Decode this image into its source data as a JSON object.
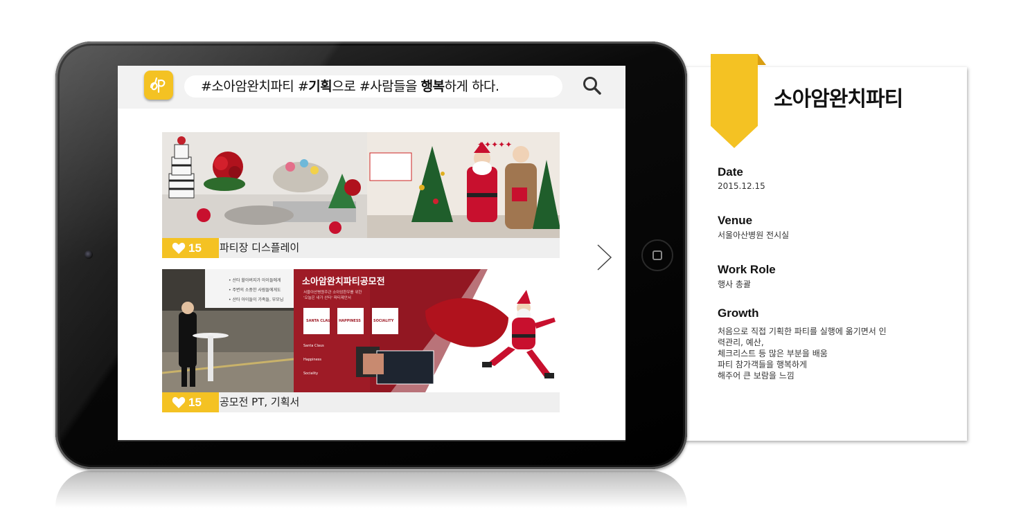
{
  "search": {
    "text_parts": [
      "#소아암완치파티 #",
      "기획",
      "으로 #사람들을 ",
      "행복",
      "하게 하다."
    ]
  },
  "posts": [
    {
      "likes": "15",
      "caption": "파티장 디스플레이"
    },
    {
      "likes": "15",
      "caption": "공모전 PT, 기획서",
      "slide": {
        "bullets": [
          "• 산타 할아버지가 아이들에게",
          "• 주변의 소중한 사람들에게도",
          "• 산타 아이들이 가족들, 부모님"
        ],
        "title": "소아암완치파티공모전",
        "subtitle": "서울아산병원주관 소아암환우를 위한",
        "subtitle2": "'오늘은 내가 산타' 파티제안서",
        "cards": [
          "SANTA CLAUS",
          "HAPPINESS",
          "SOCIALITY"
        ],
        "list": [
          "Santa Claus",
          "Happiness",
          "Sociality"
        ]
      }
    }
  ],
  "info": {
    "title": "소아암완치파티",
    "date_label": "Date",
    "date_value": "2015.12.15",
    "venue_label": "Venue",
    "venue_value": "서울아산병원 전시실",
    "role_label": "Work Role",
    "role_value": "행사 총괄",
    "growth_label": "Growth",
    "growth_lines": [
      "처음으로 직접 기획한 파티를 실행에 옮기면서 인",
      "력관리, 예산,",
      "체크리스트 등 많은 부분을 배움",
      "파티 참가객들을 행복하게",
      "해주어 큰 보람을 느낌"
    ]
  },
  "colors": {
    "accent": "#f4c223",
    "caption_bg": "#efefef",
    "topbar_bg": "#f2f2f2",
    "slide_red": "#9e1b26"
  },
  "icons": [
    "app-logo-icon",
    "search-icon",
    "heart-icon",
    "chevron-right-icon",
    "home-button-icon",
    "ribbon-bookmark-icon"
  ]
}
